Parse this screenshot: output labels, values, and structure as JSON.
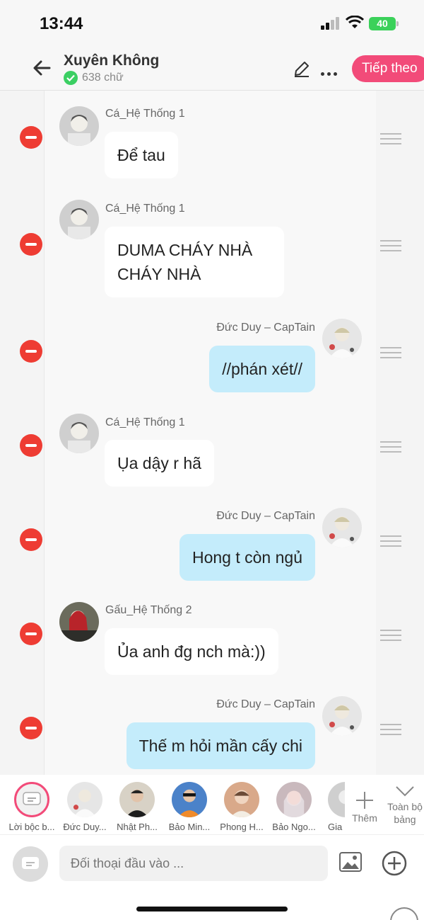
{
  "status": {
    "time": "13:44",
    "battery": "40"
  },
  "header": {
    "title": "Xuyên Không",
    "word_count": "638 chữ",
    "next_label": "Tiếp theo"
  },
  "messages": [
    {
      "speaker": "Cá_Hệ Thống 1",
      "side": "left",
      "text": "Để tau"
    },
    {
      "speaker": "Cá_Hệ Thống 1",
      "side": "left",
      "text": "DUMA CHÁY NHÀ CHÁY NHÀ"
    },
    {
      "speaker": "Đức Duy – CapTain",
      "side": "right",
      "text": "//phán xét//"
    },
    {
      "speaker": "Cá_Hệ Thống 1",
      "side": "left",
      "text": "Ụa dậy r hã"
    },
    {
      "speaker": "Đức Duy – CapTain",
      "side": "right",
      "text": "Hong t còn ngủ"
    },
    {
      "speaker": "Gấu_Hệ Thống 2",
      "side": "left",
      "text": "Ủa anh đg nch mà:))"
    },
    {
      "speaker": "Đức Duy – CapTain",
      "side": "right",
      "text": "Thế m hỏi mần cấy chi"
    }
  ],
  "characters": [
    {
      "name": "Lời bộc b..."
    },
    {
      "name": "Đức Duy..."
    },
    {
      "name": "Nhật Ph..."
    },
    {
      "name": "Bảo Min..."
    },
    {
      "name": "Phong H..."
    },
    {
      "name": "Bảo Ngo..."
    },
    {
      "name": "Gia"
    }
  ],
  "char_actions": {
    "more": "Thêm",
    "all": "Toàn bộ bảng"
  },
  "input": {
    "placeholder": "Đối thoại đầu vào ..."
  },
  "colors": {
    "accent": "#f24b79",
    "bubble_right": "#c4ecfb",
    "delete": "#ee3c33"
  }
}
